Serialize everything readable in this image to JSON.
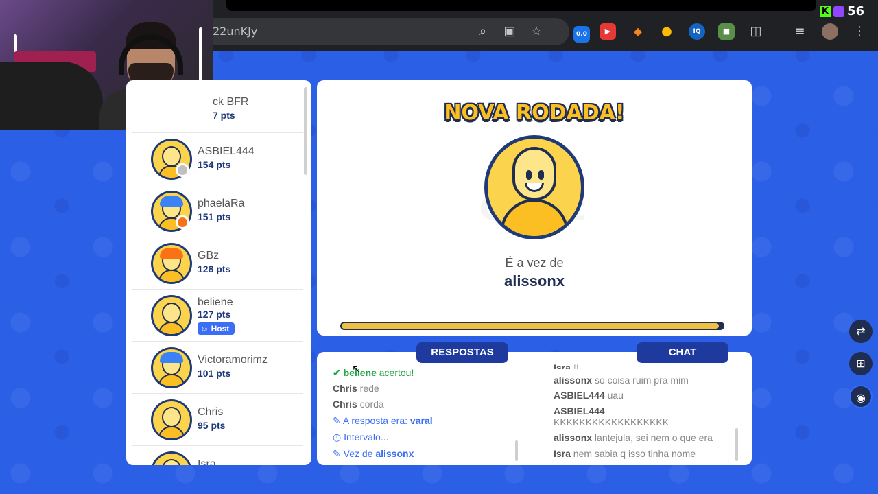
{
  "browser": {
    "address_text": "22unKJy",
    "counter_value": "56",
    "extension_badge": "0.0"
  },
  "players": [
    {
      "name": "ck BFR",
      "points": "7 pts",
      "hair": "#3a2a1a",
      "status": null
    },
    {
      "name": "ASBIEL444",
      "points": "154 pts",
      "hair": null,
      "status": "#c0c0c0"
    },
    {
      "name": "phaelaRa",
      "points": "151 pts",
      "hair": "#3b82f6",
      "status": "#f97316"
    },
    {
      "name": "GBz",
      "points": "128 pts",
      "hair": "#f97316",
      "status": null
    },
    {
      "name": "beliene",
      "points": "127 pts",
      "hair": null,
      "status": null,
      "host": "Host"
    },
    {
      "name": "Victoramorimz",
      "points": "101 pts",
      "hair": "#3b82f6",
      "status": null
    },
    {
      "name": "Chris",
      "points": "95 pts",
      "hair": null,
      "status": null
    },
    {
      "name": "Isra",
      "points": "",
      "hair": null,
      "status": null
    }
  ],
  "round": {
    "title": "NOVA RODADA!",
    "turn_label": "É a vez de",
    "turn_name": "alissonx",
    "watermark": "Gartic",
    "timer_progress": 0.99
  },
  "tabs": {
    "answers": "RESPOSTAS",
    "chat": "CHAT"
  },
  "answers": {
    "line1_name": "beliene",
    "line1_text": " acertou!",
    "line2_name": "Chris",
    "line2_text": " rede",
    "line3_name": "Chris",
    "line3_text": " corda",
    "line4_prefix": "A resposta era: ",
    "line4_word": "varal",
    "line5": "Intervalo...",
    "line6_prefix": "Vez de ",
    "line6_name": "alissonx"
  },
  "chat": {
    "line0_name": "Isra",
    "line0_text": "!!",
    "line1_name": "alissonx",
    "line1_text": " so coisa ruim pra mim",
    "line2_name": "ASBIEL444",
    "line2_text": " uau",
    "line3_name": "ASBIEL444",
    "line3_text": "KKKKKKKKKKKKKKKKKK",
    "line4_name": "alissonx",
    "line4_text": " lantejula, sei nem o que era",
    "line5_name": "Isra",
    "line5_text": " nem sabia q isso tinha nome"
  },
  "colors": {
    "page_bg": "#2b5fe6",
    "accent_navy": "#1f3a9e",
    "title_yellow": "#fbbf24",
    "correct_green": "#22a64a",
    "link_blue": "#3b6ef5"
  }
}
